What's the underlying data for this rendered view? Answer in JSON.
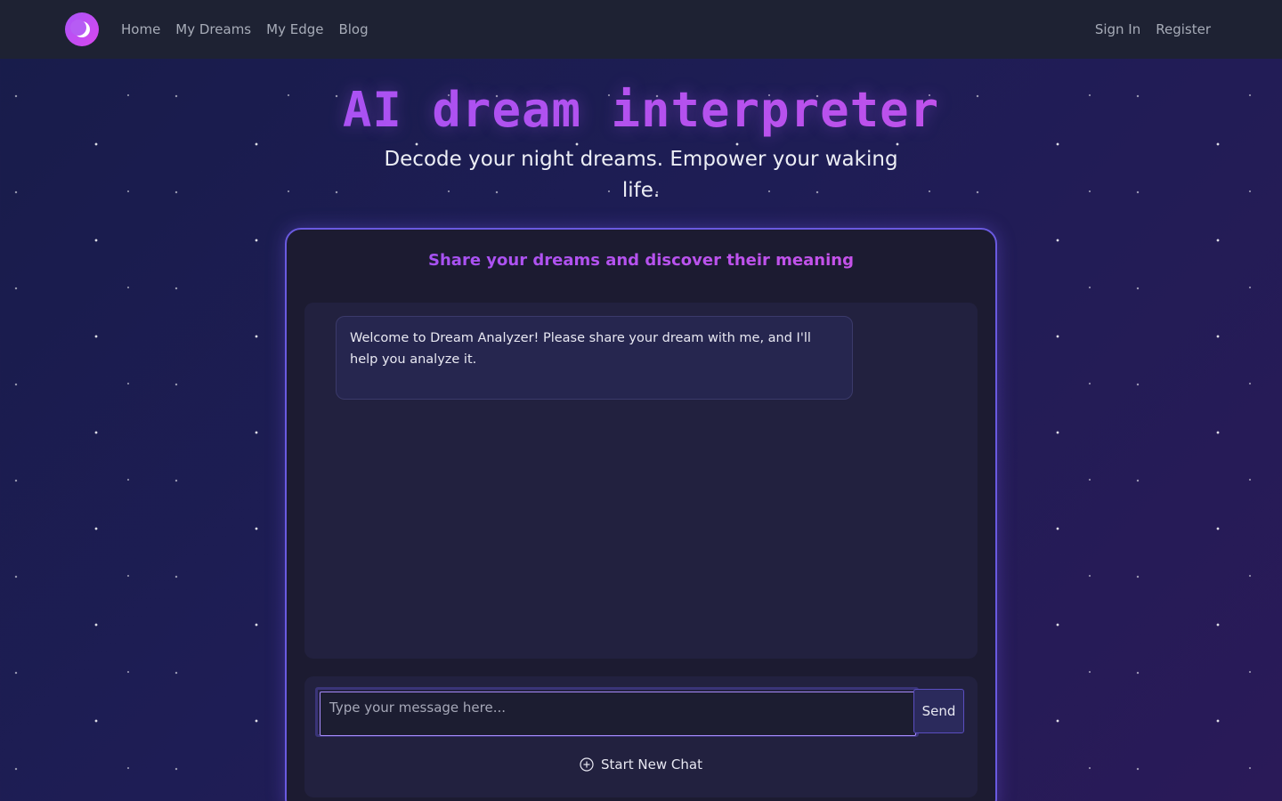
{
  "nav": {
    "links": [
      {
        "label": "Home"
      },
      {
        "label": "My Dreams"
      },
      {
        "label": "My Edge"
      },
      {
        "label": "Blog"
      }
    ],
    "auth": {
      "sign_in": "Sign In",
      "register": "Register"
    },
    "logo_icon": "crescent-moon-icon"
  },
  "hero": {
    "title": "AI dream interpreter",
    "subtitle": "Decode your night dreams. Empower your waking life."
  },
  "chat": {
    "heading": "Share your dreams and discover their meaning",
    "messages": [
      {
        "role": "assistant",
        "text": "Welcome to Dream Analyzer! Please share your dream with me, and I'll help you analyze it."
      }
    ],
    "input": {
      "value": "",
      "placeholder": "Type your message here..."
    },
    "send_label": "Send",
    "new_chat_label": "Start New Chat",
    "new_chat_icon": "plus-circle-icon"
  },
  "colors": {
    "accent": "#a855f7",
    "accent_pink": "#d946ef",
    "card_border": "#6a5ae0",
    "navbar_bg": "#1e2233"
  }
}
